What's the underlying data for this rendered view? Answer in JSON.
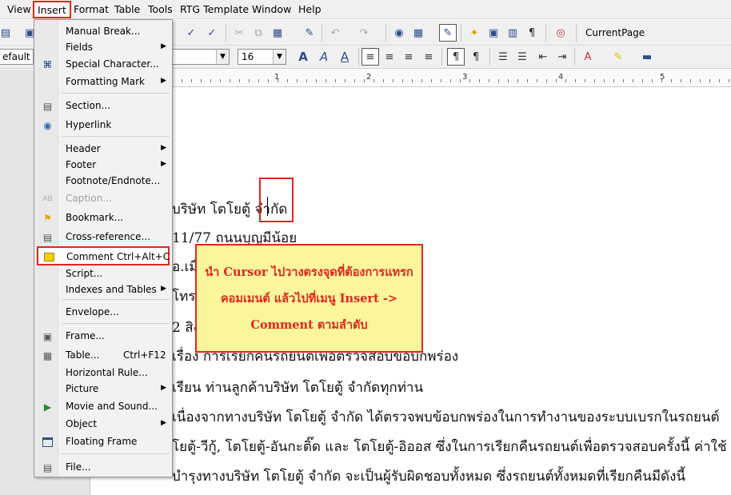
{
  "menubar": {
    "items": [
      "View",
      "Insert",
      "Format",
      "Table",
      "Tools",
      "RTG Template",
      "Window",
      "Help"
    ]
  },
  "toolbar": {
    "style_value": "efault",
    "size_value": "16",
    "current_page_label": "CurrentPage"
  },
  "ruler": {
    "labels": [
      "1",
      "2",
      "3",
      "4",
      "5"
    ]
  },
  "insert_menu": {
    "items": [
      {
        "label": "Manual Break...",
        "icon": "none"
      },
      {
        "label": "Fields",
        "submenu": true
      },
      {
        "label": "Special Character...",
        "icon": "special-character-icon"
      },
      {
        "label": "Formatting Mark",
        "submenu": true
      },
      {
        "label": "Section...",
        "icon": "section-icon"
      },
      {
        "label": "Hyperlink",
        "icon": "hyperlink-icon"
      },
      {
        "label": "Header",
        "submenu": true
      },
      {
        "label": "Footer",
        "submenu": true
      },
      {
        "label": "Footnote/Endnote..."
      },
      {
        "label": "Caption...",
        "disabled": true,
        "icon": "caption-icon"
      },
      {
        "label": "Bookmark...",
        "icon": "bookmark-icon"
      },
      {
        "label": "Cross-reference...",
        "icon": "cross-reference-icon"
      },
      {
        "label": "Comment",
        "shortcut": "Ctrl+Alt+C",
        "icon": "comment-icon",
        "highlighted": true
      },
      {
        "label": "Script..."
      },
      {
        "label": "Indexes and Tables",
        "submenu": true
      },
      {
        "label": "Envelope..."
      },
      {
        "label": "Frame...",
        "icon": "frame-icon"
      },
      {
        "label": "Table...",
        "shortcut": "Ctrl+F12",
        "icon": "table-icon"
      },
      {
        "label": "Horizontal Rule..."
      },
      {
        "label": "Picture",
        "submenu": true
      },
      {
        "label": "Movie and Sound...",
        "icon": "movie-icon"
      },
      {
        "label": "Object",
        "submenu": true
      },
      {
        "label": "Floating Frame",
        "icon": "floating-frame-icon"
      },
      {
        "label": "File...",
        "icon": "file-icon"
      }
    ]
  },
  "document": {
    "lines": [
      "บริษัท โตโยตู้ จำกัด",
      "11/77 ถนนบุญมีน้อย",
      "อ.เมื",
      "โทร",
      "2 สิง",
      "เรื่อง การเรียกคืนรถยนต์เพื่อตรวจสอบข้อบกพร่อง",
      "เรียน ท่านลูกค้าบริษัท โตโยตู้ จำกัดทุกท่าน",
      "เนื่องจากทางบริษัท โตโยตู้ จำกัด ได้ตรวจพบข้อบกพร่องในการทำงานของระบบเบรกในรถยนต์",
      "โยตู้-วีกู้, โตโยตู้-อันกะติ๊ด และ โตโยตู้-อิออส ซึ่งในการเรียกคืนรถยนต์เพื่อตรวจสอบครั้งนี้ ค่าใช้",
      "บำรุงทางบริษัท โตโยตู้ จำกัด จะเป็นผู้รับผิดชอบทั้งหมด ซึ่งรถยนต์ทั้งหมดที่เรียกคืนมีดังนี้"
    ]
  },
  "callout": {
    "lines": [
      "นำ Cursor ไปวางตรงจุดที่ต้องการแทรก",
      "คอมเมนต์ แล้วไปที่เมนู Insert ->",
      "Comment ตามลำดับ"
    ]
  },
  "colors": {
    "highlight_red": "#e2261c",
    "callout_bg": "#fbf59c",
    "menu_bg": "#f2f2f2"
  }
}
